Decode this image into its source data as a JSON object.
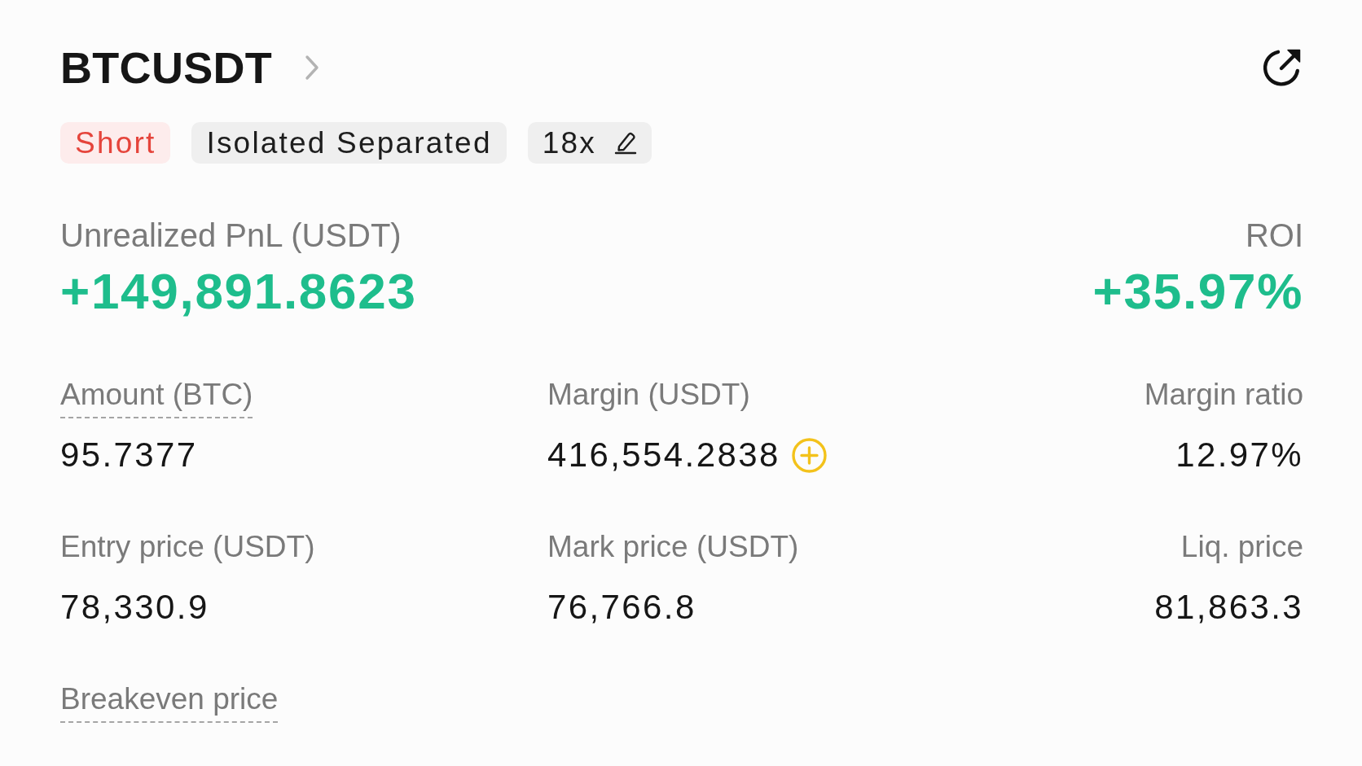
{
  "header": {
    "symbol": "BTCUSDT"
  },
  "tags": [
    {
      "kind": "side",
      "label": "Short"
    },
    {
      "kind": "margin_mode",
      "label": "Isolated Separated"
    },
    {
      "kind": "leverage",
      "label": "18x"
    }
  ],
  "pnl": {
    "label": "Unrealized PnL (USDT)",
    "value": "+149,891.8623"
  },
  "roi": {
    "label": "ROI",
    "value": "+35.97%"
  },
  "stats": [
    {
      "label": "Amount (BTC)",
      "value": "95.7377",
      "underlined": true,
      "addable": false
    },
    {
      "label": "Margin (USDT)",
      "value": "416,554.2838",
      "underlined": false,
      "addable": true
    },
    {
      "label": "Margin ratio",
      "value": "12.97%",
      "underlined": false,
      "addable": false
    },
    {
      "label": "Entry price (USDT)",
      "value": "78,330.9",
      "underlined": false,
      "addable": false
    },
    {
      "label": "Mark price (USDT)",
      "value": "76,766.8",
      "underlined": false,
      "addable": false
    },
    {
      "label": "Liq. price",
      "value": "81,863.3",
      "underlined": false,
      "addable": false
    },
    {
      "label": "Breakeven price",
      "underlined": true,
      "addable": false
    }
  ]
}
